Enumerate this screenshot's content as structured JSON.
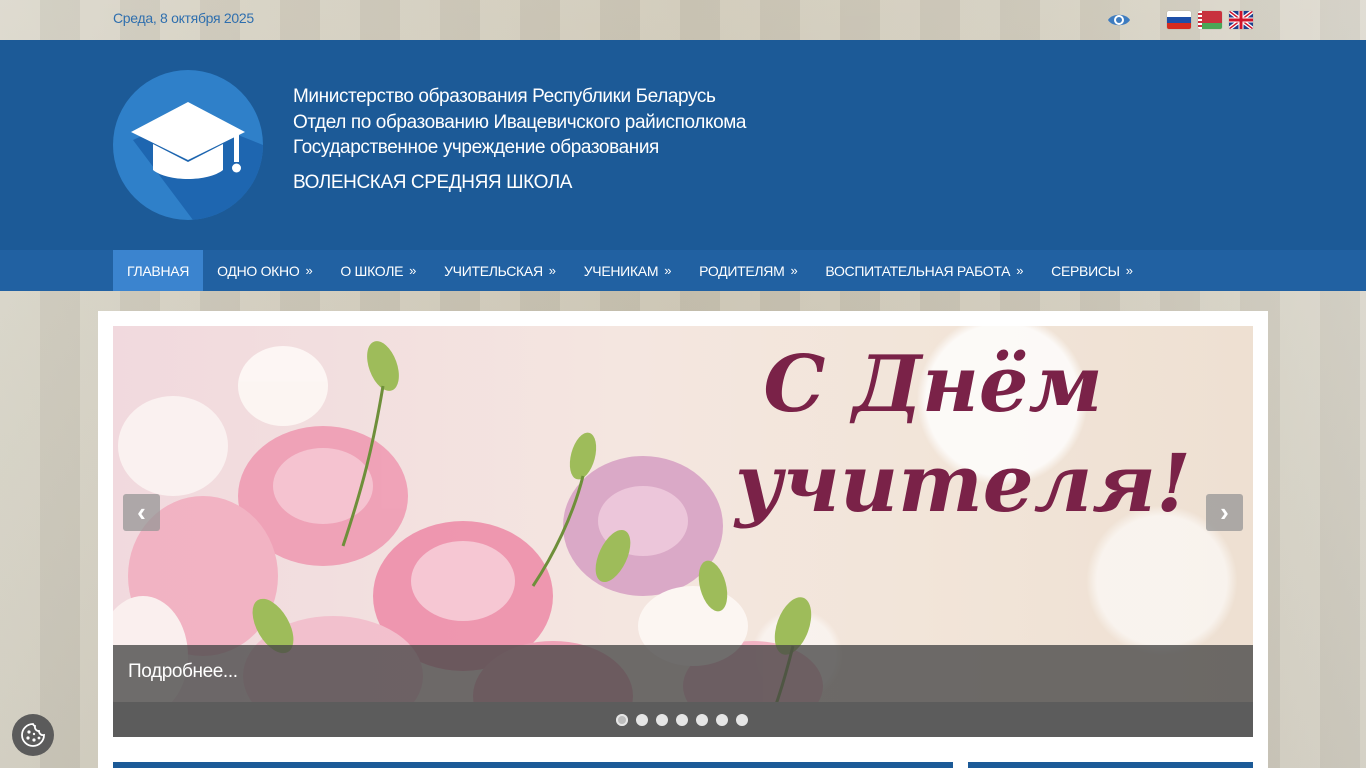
{
  "topbar": {
    "date": "Среда, 8 октября 2025",
    "accessibility_icon": "eye-icon",
    "languages": [
      "ru",
      "by",
      "en"
    ]
  },
  "header": {
    "line1": "Министерство образования Республики Беларусь",
    "line2": "Отдел по образованию Ивацевичского райисполкома",
    "line3": "Государственное учреждение образования",
    "school": "ВОЛЕНСКАЯ СРЕДНЯЯ ШКОЛА",
    "logo_icon": "graduation-cap-icon"
  },
  "nav": {
    "items": [
      {
        "label": "ГЛАВНАЯ",
        "arrow": ""
      },
      {
        "label": "ОДНО ОКНО",
        "arrow": "»"
      },
      {
        "label": "О ШКОЛЕ",
        "arrow": "»"
      },
      {
        "label": "УЧИТЕЛЬСКАЯ",
        "arrow": "»"
      },
      {
        "label": "УЧЕНИКАМ",
        "arrow": "»"
      },
      {
        "label": "РОДИТЕЛЯМ",
        "arrow": "»"
      },
      {
        "label": "ВОСПИТАТЕЛЬНАЯ РАБОТА",
        "arrow": "»"
      },
      {
        "label": "СЕРВИСЫ",
        "arrow": "»"
      }
    ]
  },
  "slider": {
    "title_line1": "С Днём",
    "title_line2": "учителя!",
    "caption": "Подробнее...",
    "prev": "‹",
    "next": "›",
    "slide_count": 7,
    "active_index": 0
  },
  "colors": {
    "header_blue": "#1c5a97",
    "nav_blue": "#2161a2",
    "nav_active": "#3b84cf",
    "title_color": "#7a2248"
  }
}
